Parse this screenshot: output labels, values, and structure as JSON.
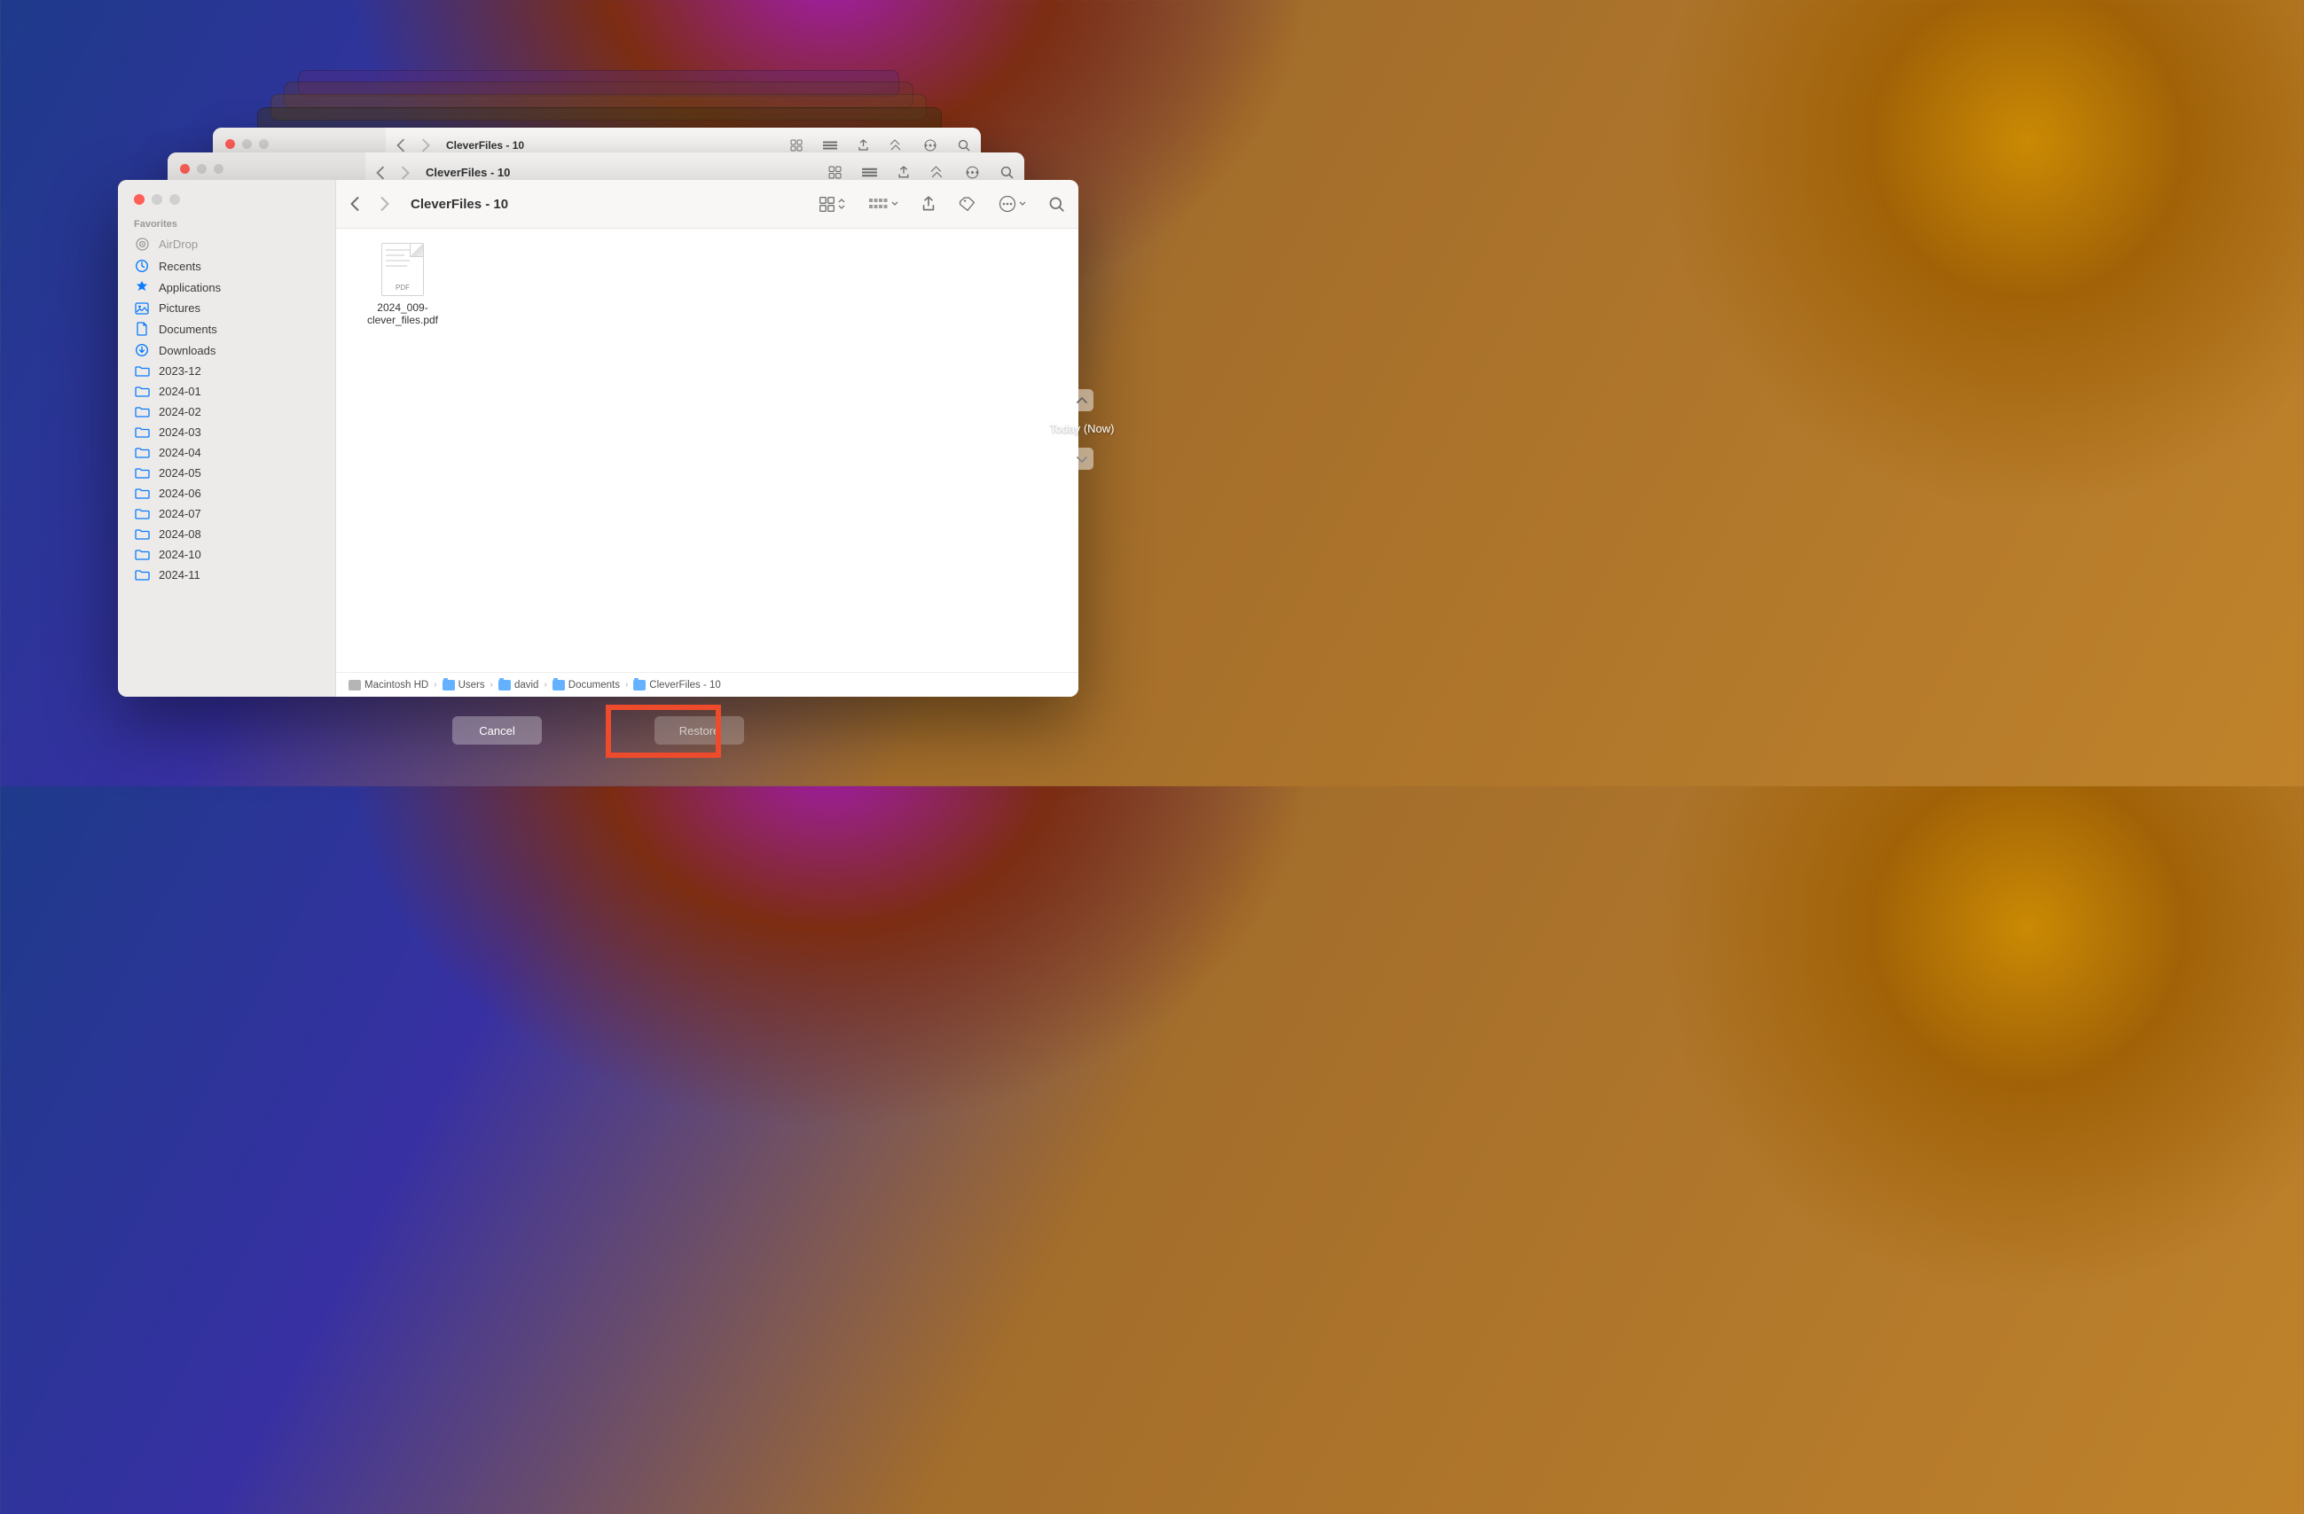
{
  "stacked_windows": {
    "title": "CleverFiles - 10"
  },
  "window": {
    "title": "CleverFiles - 10",
    "sidebar": {
      "section_label": "Favorites",
      "items": [
        {
          "icon": "airdrop",
          "label": "AirDrop",
          "gray": true
        },
        {
          "icon": "clock",
          "label": "Recents"
        },
        {
          "icon": "apps",
          "label": "Applications"
        },
        {
          "icon": "pictures",
          "label": "Pictures"
        },
        {
          "icon": "doc",
          "label": "Documents"
        },
        {
          "icon": "download",
          "label": "Downloads"
        },
        {
          "icon": "folder",
          "label": "2023-12"
        },
        {
          "icon": "folder",
          "label": "2024-01"
        },
        {
          "icon": "folder",
          "label": "2024-02"
        },
        {
          "icon": "folder",
          "label": "2024-03"
        },
        {
          "icon": "folder",
          "label": "2024-04"
        },
        {
          "icon": "folder",
          "label": "2024-05"
        },
        {
          "icon": "folder",
          "label": "2024-06"
        },
        {
          "icon": "folder",
          "label": "2024-07"
        },
        {
          "icon": "folder",
          "label": "2024-08"
        },
        {
          "icon": "folder",
          "label": "2024-10"
        },
        {
          "icon": "folder",
          "label": "2024-11"
        }
      ]
    },
    "file": {
      "name": "2024_009-clever_files.pdf",
      "badge": "PDF"
    },
    "path": [
      {
        "icon": "hd",
        "label": "Macintosh HD"
      },
      {
        "icon": "folder",
        "label": "Users"
      },
      {
        "icon": "folder",
        "label": "david"
      },
      {
        "icon": "folder",
        "label": "Documents"
      },
      {
        "icon": "folder",
        "label": "CleverFiles - 10"
      }
    ]
  },
  "time_machine": {
    "label": "Today (Now)"
  },
  "buttons": {
    "cancel": "Cancel",
    "restore": "Restore"
  }
}
